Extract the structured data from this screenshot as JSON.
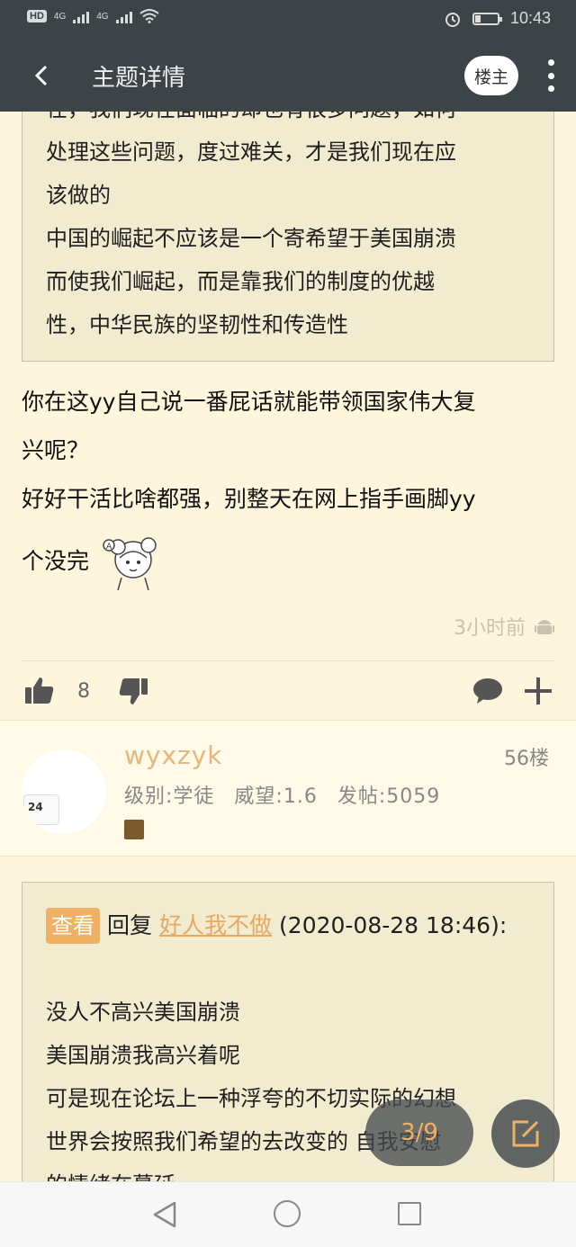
{
  "status_bar": {
    "left_icons": [
      "hd-icon",
      "4g-signal-icon",
      "4g-signal-icon",
      "wifi-icon"
    ],
    "hd_label": "HD",
    "network_label_1": "4G",
    "network_label_2": "4G",
    "right_icons": [
      "alarm-icon",
      "battery-icon"
    ],
    "time": "10:43"
  },
  "header": {
    "title": "主题详情",
    "op_button_label": "楼主"
  },
  "post_55": {
    "quote_lines": [
      "在，我们现在面临的却也有很多问题，如何",
      "处理这些问题，度过难关，才是我们现在应",
      "该做的",
      "中国的崛起不应该是一个寄希望于美国崩溃",
      "而使我们崛起，而是靠我们的制度的优越",
      "性，中华民族的坚韧性和传造性"
    ],
    "reply_lines": [
      "你在这yy自己说一番屁话就能带领国家伟大复",
      "兴呢？",
      "好好干活比啥都强，别整天在网上指手画脚yy",
      "个没完"
    ],
    "time_ago": "3小时前",
    "like_count": "8"
  },
  "post_56": {
    "username": "wyxzyk",
    "floor": "56楼",
    "level": "级别:学徒",
    "prestige": "威望:1.6",
    "posts": "发帖:5059",
    "avatar_label": "24",
    "quote_view_tag": "查看",
    "quote_reply_word": "回复",
    "quote_user": "好人我不做",
    "quote_date": "(2020-08-28 18:46):",
    "quote_lines": [
      "没人不高兴美国崩溃",
      "美国崩溃我高兴着呢",
      "可是现在论坛上一种浮夸的不切实际的幻想",
      "世界会按照我们希望的去改变的 自我安慰",
      "的情绪在蔓延"
    ]
  },
  "page_indicator": "3/9",
  "colors": {
    "header_bg": "#3d4447",
    "page_bg": "#fdf6dc",
    "quote_bg": "#f1ebcf",
    "accent_orange": "#f0b164",
    "username_color": "#e6b67a"
  }
}
